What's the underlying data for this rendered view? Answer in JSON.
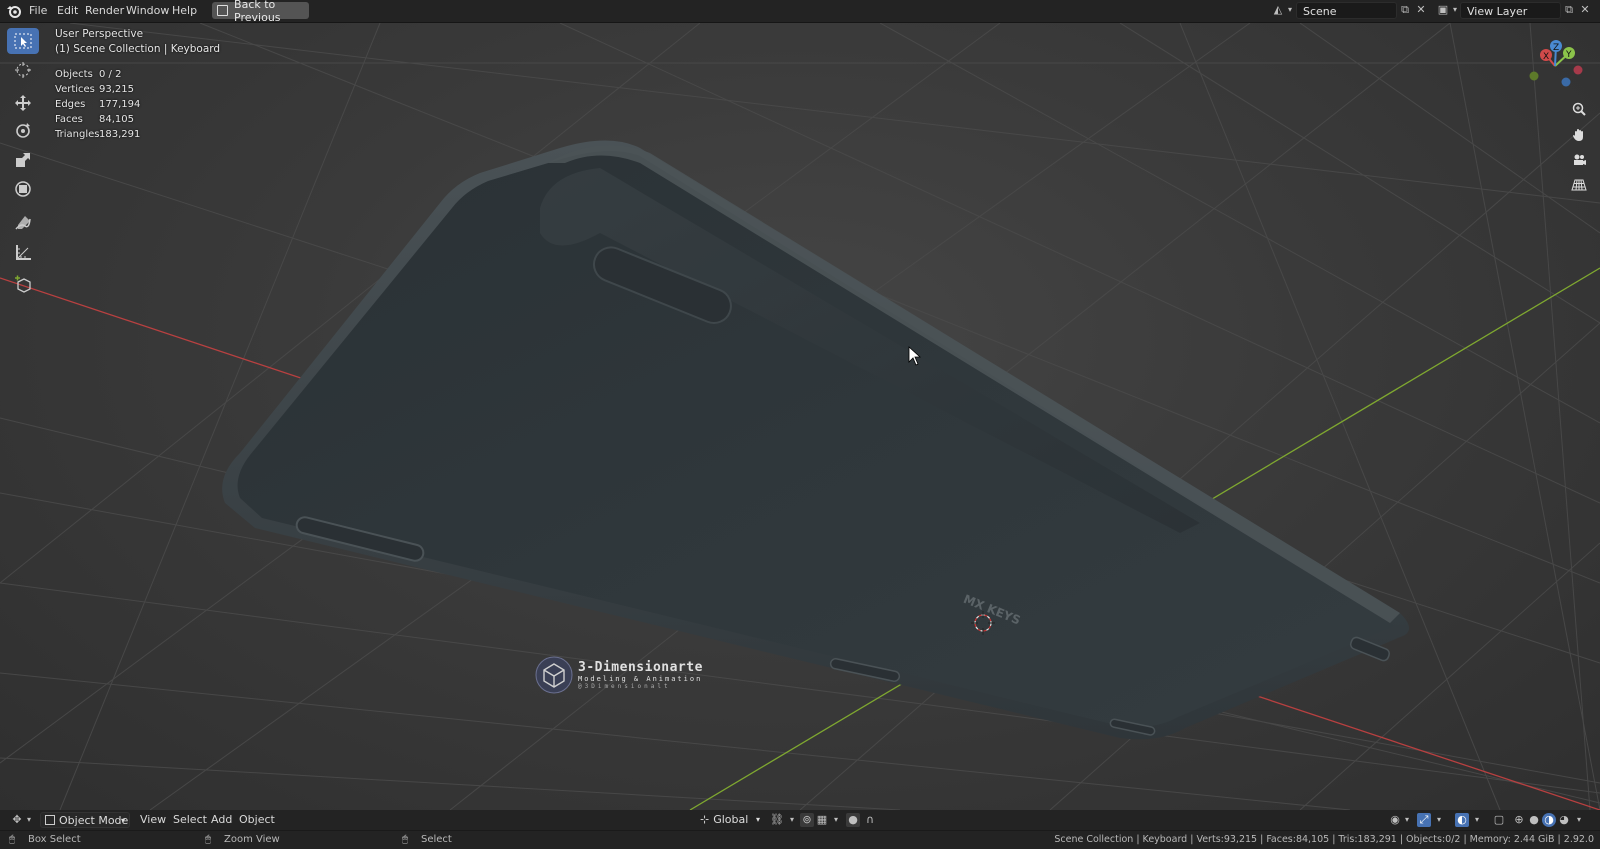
{
  "topbar": {
    "menus": [
      "File",
      "Edit",
      "Render",
      "Window",
      "Help"
    ],
    "back_button": "Back to Previous",
    "scene_name": "Scene",
    "view_layer_name": "View Layer"
  },
  "viewport": {
    "perspective": "User Perspective",
    "collection": "(1) Scene Collection | Keyboard",
    "stats": [
      {
        "label": "Objects",
        "value": "0 / 2"
      },
      {
        "label": "Vertices",
        "value": "93,215"
      },
      {
        "label": "Edges",
        "value": "177,194"
      },
      {
        "label": "Faces",
        "value": "84,105"
      },
      {
        "label": "Triangles",
        "value": "183,291"
      }
    ],
    "logo_text": "MX KEYS",
    "gizmo_axes": {
      "x": "X",
      "y": "Y",
      "z": "Z"
    }
  },
  "watermark": {
    "title": "3-Dimensionarte",
    "subtitle": "Modeling & Animation",
    "handle": "@3Dimensionalt"
  },
  "bottombar": {
    "mode": "Object Mode",
    "menus": [
      "View",
      "Select",
      "Add",
      "Object"
    ],
    "transform": "Global"
  },
  "statusbar": {
    "hints": [
      {
        "icon": "mouse-left-icon",
        "label": "Box Select"
      },
      {
        "icon": "mouse-middle-icon",
        "label": "Zoom View"
      },
      {
        "icon": "mouse-right-icon",
        "label": "Select"
      }
    ],
    "info": "Scene Collection | Keyboard | Verts:93,215 | Faces:84,105 | Tris:183,291 | Objects:0/2 | Memory: 2.44 GiB | 2.92.0"
  },
  "colors": {
    "accent": "#4772b3",
    "x_axis": "#d24a4a",
    "y_axis": "#8bc34a",
    "z_axis": "#4a8ad2",
    "keyboard": "#2c3337"
  }
}
